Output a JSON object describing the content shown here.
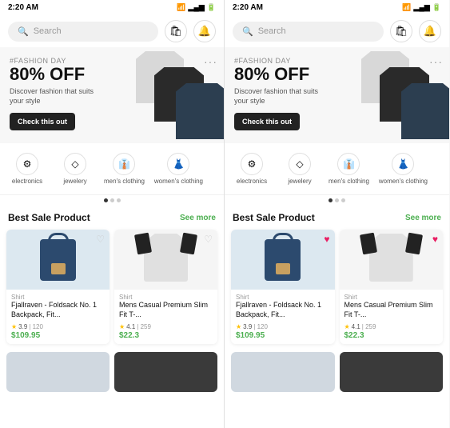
{
  "screens": [
    {
      "id": "left",
      "statusBar": {
        "time": "2:20 AM",
        "icons": "📶 📶 🔋"
      },
      "search": {
        "placeholder": "Search"
      },
      "banner": {
        "tag": "#FASHION DAY",
        "discount": "80% OFF",
        "description": "Discover fashion that suits your style",
        "buttonLabel": "Check this out"
      },
      "categories": [
        {
          "label": "electronics",
          "icon": "⚙"
        },
        {
          "label": "jewelery",
          "icon": "◇"
        },
        {
          "label": "men's clothing",
          "icon": "👤"
        },
        {
          "label": "women's clothing",
          "icon": "👤"
        }
      ],
      "section": {
        "title": "Best Sale Product",
        "seeMore": "See more"
      },
      "products": [
        {
          "type": "Shirt",
          "name": "Fjallraven - Foldsack No. 1 Backpack, Fit...",
          "rating": "3.9",
          "count": "120",
          "price": "$109.95",
          "imgType": "bag",
          "heartFilled": false
        },
        {
          "type": "Shirt",
          "name": "Mens Casual Premium Slim Fit T-...",
          "rating": "4.1",
          "count": "259",
          "price": "$22.3",
          "imgType": "shirt",
          "heartFilled": false
        }
      ]
    },
    {
      "id": "right",
      "statusBar": {
        "time": "2:20 AM",
        "icons": "📶 📶 🔋"
      },
      "search": {
        "placeholder": "Search"
      },
      "banner": {
        "tag": "#FASHION DAY",
        "discount": "80% OFF",
        "description": "Discover fashion that suits your style",
        "buttonLabel": "Check this out"
      },
      "categories": [
        {
          "label": "electronics",
          "icon": "⚙"
        },
        {
          "label": "jewelery",
          "icon": "◇"
        },
        {
          "label": "men's clothing",
          "icon": "👤"
        },
        {
          "label": "women's clothing",
          "icon": "👤"
        }
      ],
      "section": {
        "title": "Best Sale Product",
        "seeMore": "See more"
      },
      "products": [
        {
          "type": "Shirt",
          "name": "Fjallraven - Foldsack No. 1 Backpack, Fit...",
          "rating": "3.9",
          "count": "120",
          "price": "$109.95",
          "imgType": "bag",
          "heartFilled": true
        },
        {
          "type": "Shirt",
          "name": "Mens Casual Premium Slim Fit T-...",
          "rating": "4.1",
          "count": "259",
          "price": "$22.3",
          "imgType": "shirt",
          "heartFilled": true
        }
      ]
    }
  ]
}
